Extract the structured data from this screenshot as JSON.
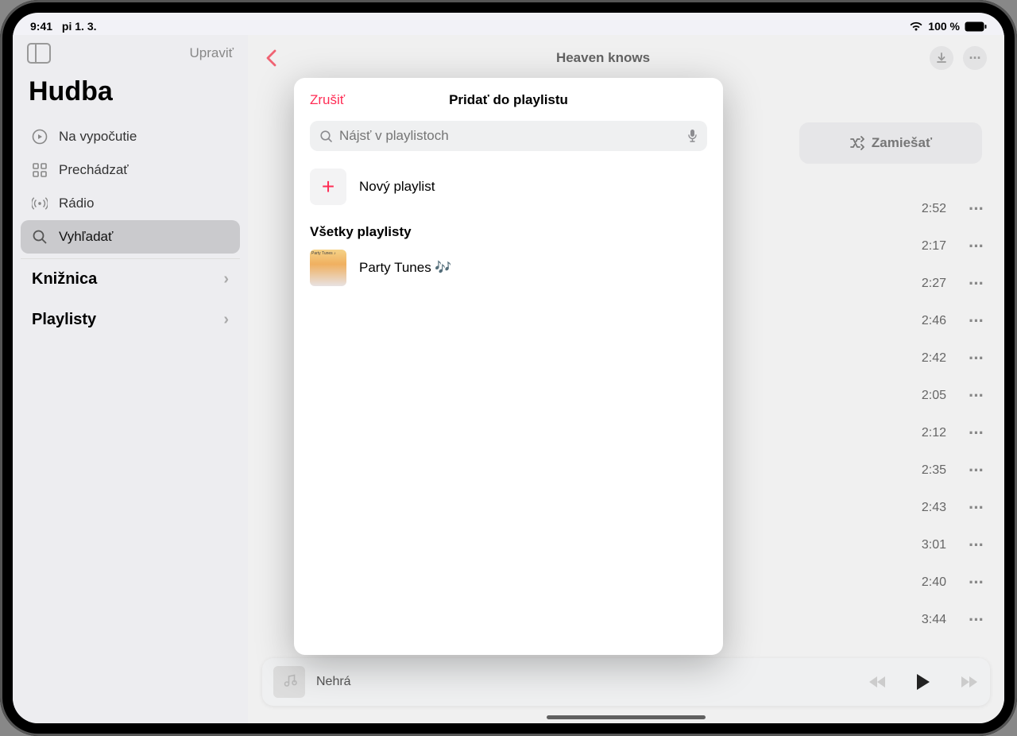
{
  "statusbar": {
    "time": "9:41",
    "date": "pi 1. 3.",
    "battery": "100 %"
  },
  "sidebar": {
    "edit": "Upraviť",
    "app_title": "Hudba",
    "items": [
      {
        "label": "Na vypočutie"
      },
      {
        "label": "Prechádzať"
      },
      {
        "label": "Rádio"
      },
      {
        "label": "Vyhľadať"
      }
    ],
    "library": "Knižnica",
    "playlists": "Playlisty"
  },
  "main": {
    "title": "Heaven knows",
    "shuffle": "Zamiešať",
    "tracks": [
      {
        "time": "2:52"
      },
      {
        "time": "2:17"
      },
      {
        "time": "2:27"
      },
      {
        "time": "2:46"
      },
      {
        "time": "2:42"
      },
      {
        "time": "2:05"
      },
      {
        "time": "2:12"
      },
      {
        "time": "2:35"
      },
      {
        "time": "2:43"
      },
      {
        "time": "3:01"
      },
      {
        "time": "2:40"
      },
      {
        "time": "3:44"
      }
    ]
  },
  "nowplaying": {
    "status": "Nehrá"
  },
  "modal": {
    "cancel": "Zrušiť",
    "title": "Pridať do playlistu",
    "search_placeholder": "Nájsť v playlistoch",
    "new_playlist": "Nový playlist",
    "section": "Všetky playlisty",
    "playlists": [
      {
        "name": "Party Tunes 🎶"
      }
    ]
  }
}
